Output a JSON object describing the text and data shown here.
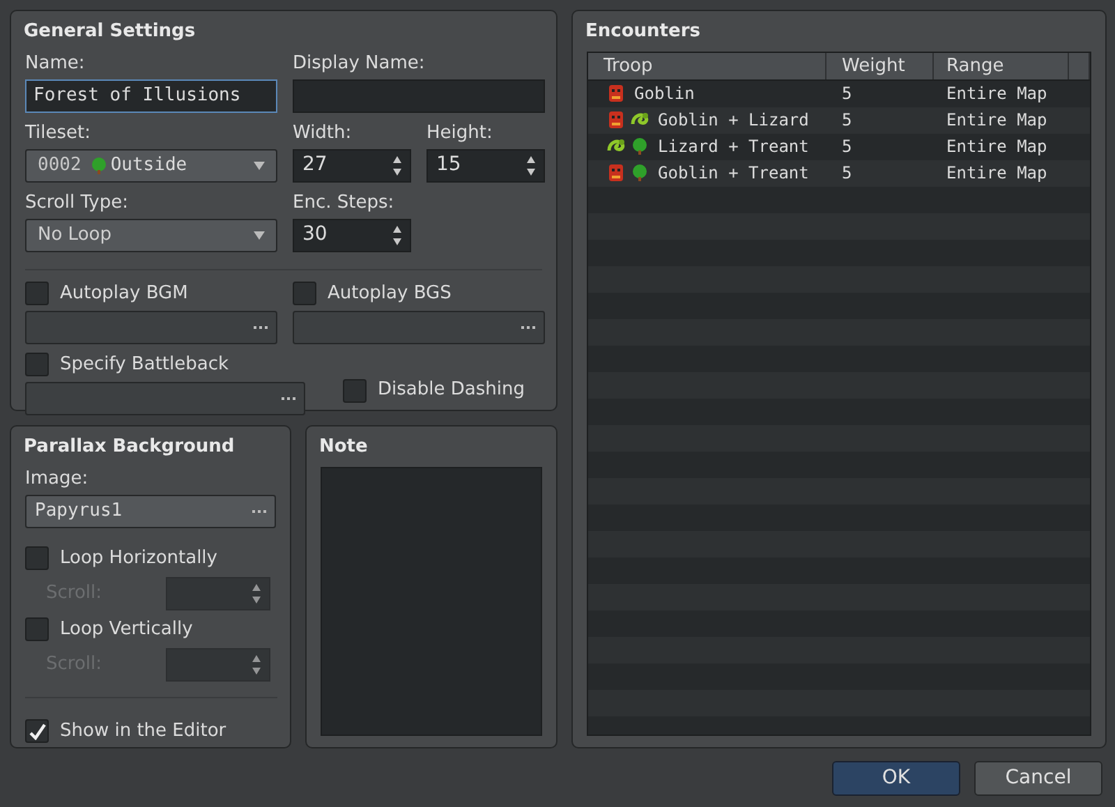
{
  "general": {
    "title": "General Settings",
    "name": {
      "label": "Name:",
      "value": "Forest of Illusions",
      "focused": true
    },
    "display_name": {
      "label": "Display Name:"
    },
    "tileset": {
      "label": "Tileset:",
      "number": "0002",
      "value": "Outside"
    },
    "width": {
      "label": "Width:",
      "value": "27"
    },
    "height": {
      "label": "Height:",
      "value": "15"
    },
    "scroll_type": {
      "label": "Scroll Type:",
      "value": "No Loop"
    },
    "enc_steps": {
      "label": "Enc. Steps:",
      "value": "30"
    },
    "autoplay_bgm": {
      "label": "Autoplay BGM",
      "checked": false
    },
    "autoplay_bgs": {
      "label": "Autoplay BGS",
      "checked": false
    },
    "specify_battleback": {
      "label": "Specify Battleback",
      "checked": false
    },
    "disable_dashing": {
      "label": "Disable Dashing",
      "checked": false
    }
  },
  "parallax": {
    "title": "Parallax Background",
    "image": {
      "label": "Image:",
      "value": "Papyrus1"
    },
    "loop_horizontally": {
      "label": "Loop Horizontally",
      "checked": false,
      "scroll_label": "Scroll:",
      "disabled": true
    },
    "loop_vertically": {
      "label": "Loop Vertically",
      "checked": false,
      "scroll_label": "Scroll:",
      "disabled": true
    },
    "show_in_editor": {
      "label": "Show in the Editor",
      "checked": true
    }
  },
  "note": {
    "title": "Note"
  },
  "encounters": {
    "title": "Encounters",
    "columns": [
      "Troop",
      "Weight",
      "Range"
    ],
    "rows": [
      {
        "members": [
          {
            "kind": "goblin"
          }
        ],
        "troop": "Goblin",
        "weight": "5",
        "range": "Entire Map"
      },
      {
        "members": [
          {
            "kind": "goblin"
          },
          {
            "kind": "lizard"
          }
        ],
        "troop": "Goblin + Lizard",
        "weight": "5",
        "range": "Entire Map"
      },
      {
        "members": [
          {
            "kind": "lizard"
          },
          {
            "kind": "tree"
          }
        ],
        "troop": "Lizard + Treant",
        "weight": "5",
        "range": "Entire Map"
      },
      {
        "members": [
          {
            "kind": "goblin"
          },
          {
            "kind": "tree"
          }
        ],
        "troop": "Goblin + Treant",
        "weight": "5",
        "range": "Entire Map"
      }
    ]
  },
  "buttons": [
    {
      "label": "OK",
      "kind": "primary"
    },
    {
      "label": "Cancel",
      "kind": "secondary"
    }
  ]
}
